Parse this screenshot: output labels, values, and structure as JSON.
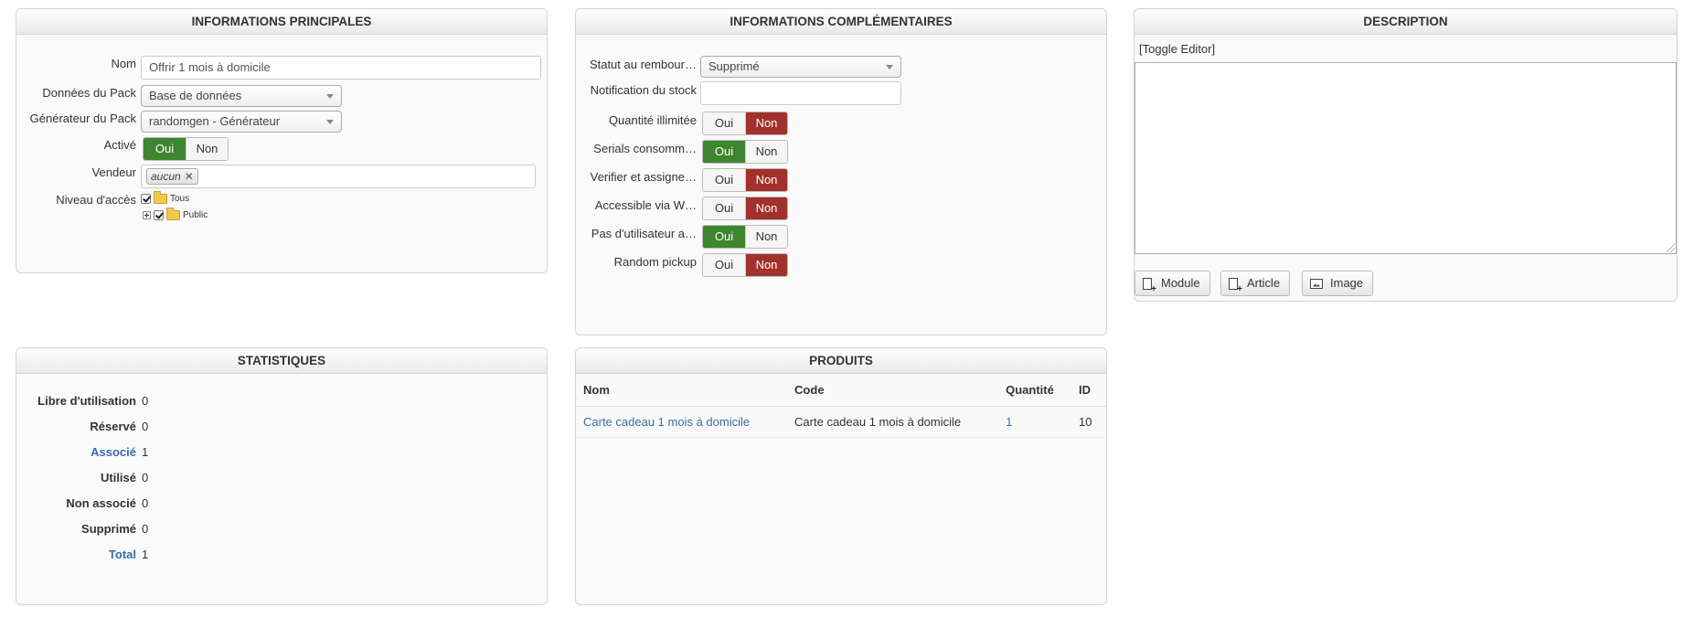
{
  "panels": {
    "main": {
      "title": "INFORMATIONS PRINCIPALES",
      "nom_label": "Nom",
      "nom_value": "Offrir 1 mois à domicile",
      "donnees_label": "Données du Pack",
      "donnees_value": "Base de données",
      "generateur_label": "Générateur du Pack",
      "generateur_value": "randomgen - Générateur",
      "active_label": "Activé",
      "active_yes": "Oui",
      "active_no": "Non",
      "vendeur_label": "Vendeur",
      "vendeur_tag": "aucun",
      "niveau_label": "Niveau d'accès",
      "tree_tous": "Tous",
      "tree_public": "Public"
    },
    "complementary": {
      "title": "INFORMATIONS COMPLÉMENTAIRES",
      "statut_label": "Statut au rembour…",
      "statut_value": "Supprimé",
      "notification_label": "Notification du stock",
      "notification_value": "",
      "toggles": [
        {
          "label": "Quantité illimitée",
          "yes": "Oui",
          "no": "Non",
          "active": "no"
        },
        {
          "label": "Serials consomm…",
          "yes": "Oui",
          "no": "Non",
          "active": "yes"
        },
        {
          "label": "Verifier et assigne…",
          "yes": "Oui",
          "no": "Non",
          "active": "no"
        },
        {
          "label": "Accessible via W…",
          "yes": "Oui",
          "no": "Non",
          "active": "no"
        },
        {
          "label": "Pas d'utilisateur a…",
          "yes": "Oui",
          "no": "Non",
          "active": "yes"
        },
        {
          "label": "Random pickup",
          "yes": "Oui",
          "no": "Non",
          "active": "no"
        }
      ]
    },
    "description": {
      "title": "DESCRIPTION",
      "toggle_editor": "[Toggle Editor]",
      "buttons": {
        "module": "Module",
        "article": "Article",
        "image": "Image"
      }
    },
    "stats": {
      "title": "STATISTIQUES",
      "items": [
        {
          "label": "Libre d'utilisation",
          "value": "0",
          "link": false
        },
        {
          "label": "Réservé",
          "value": "0",
          "link": false
        },
        {
          "label": "Associé",
          "value": "1",
          "link": true
        },
        {
          "label": "Utilisé",
          "value": "0",
          "link": false
        },
        {
          "label": "Non associé",
          "value": "0",
          "link": false
        },
        {
          "label": "Supprimé",
          "value": "0",
          "link": false
        },
        {
          "label": "Total",
          "value": "1",
          "link": true
        }
      ]
    },
    "products": {
      "title": "PRODUITS",
      "columns": [
        "Nom",
        "Code",
        "Quantité",
        "ID"
      ],
      "rows": [
        [
          "Carte cadeau 1 mois à domicile",
          "Carte cadeau 1 mois à domicile",
          "1",
          "10"
        ]
      ]
    }
  },
  "colors": {
    "yes_active": "#3e8530",
    "no_active": "#a3312b",
    "link": "#3a6ea5"
  }
}
